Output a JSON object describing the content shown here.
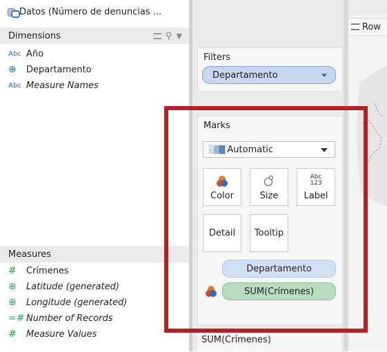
{
  "data_source": {
    "name": "Datos (Número de denuncias ..."
  },
  "dimensions": {
    "header": "Dimensions",
    "items": [
      {
        "icon": "Abc",
        "label": "Año",
        "italic": false
      },
      {
        "icon": "globe-icon",
        "label": "Departamento",
        "italic": false
      },
      {
        "icon": "Abc",
        "label": "Measure Names",
        "italic": true
      }
    ]
  },
  "measures": {
    "header": "Measures",
    "items": [
      {
        "icon": "#",
        "label": "Crímenes",
        "italic": false
      },
      {
        "icon": "globe-icon",
        "label": "Latitude (generated)",
        "italic": true
      },
      {
        "icon": "globe-icon",
        "label": "Longitude (generated)",
        "italic": true
      },
      {
        "icon": "=#",
        "label": "Number of Records",
        "italic": true
      },
      {
        "icon": "#",
        "label": "Measure Values",
        "italic": true
      }
    ]
  },
  "filters": {
    "title": "Filters",
    "pill": "Departamento"
  },
  "marks": {
    "title": "Marks",
    "mark_type": "Automatic",
    "buttons": {
      "color": "Color",
      "size": "Size",
      "label": "Label",
      "label_icon": "Abc\n123",
      "detail": "Detail",
      "tooltip": "Tooltip"
    },
    "pills": {
      "detail_field": "Departamento",
      "color_field": "SUM(Crímenes)"
    }
  },
  "legend": {
    "title": "SUM(Crímenes)"
  },
  "shelves": {
    "rows_label": "Row"
  },
  "colors": {
    "highlight": "#b52025",
    "dimension_pill": "#c6d7ee",
    "measure_pill": "#b9dbbf"
  }
}
